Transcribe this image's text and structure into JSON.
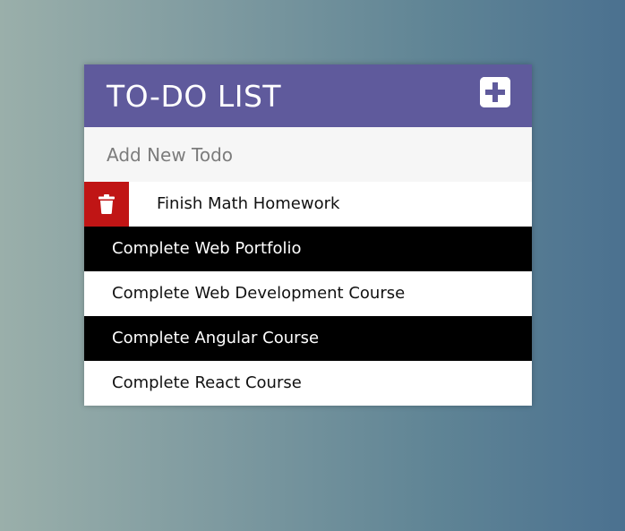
{
  "header": {
    "title": "TO-DO LIST",
    "add_icon": "plus-square-icon"
  },
  "new_todo": {
    "placeholder": "Add New Todo",
    "value": ""
  },
  "todos": [
    {
      "text": "Finish Math Homework",
      "style": "light",
      "hovered": true,
      "delete_icon": "trash-icon"
    },
    {
      "text": "Complete Web Portfolio",
      "style": "dark",
      "hovered": false
    },
    {
      "text": "Complete Web Development Course",
      "style": "light",
      "hovered": false
    },
    {
      "text": "Complete Angular Course",
      "style": "dark",
      "hovered": false
    },
    {
      "text": "Complete React Course",
      "style": "light",
      "hovered": false
    }
  ],
  "colors": {
    "header_bg": "#5f5a9c",
    "delete_bg": "#c01515",
    "input_bg": "#f6f6f6",
    "dark_row": "#000000",
    "light_row": "#ffffff"
  }
}
